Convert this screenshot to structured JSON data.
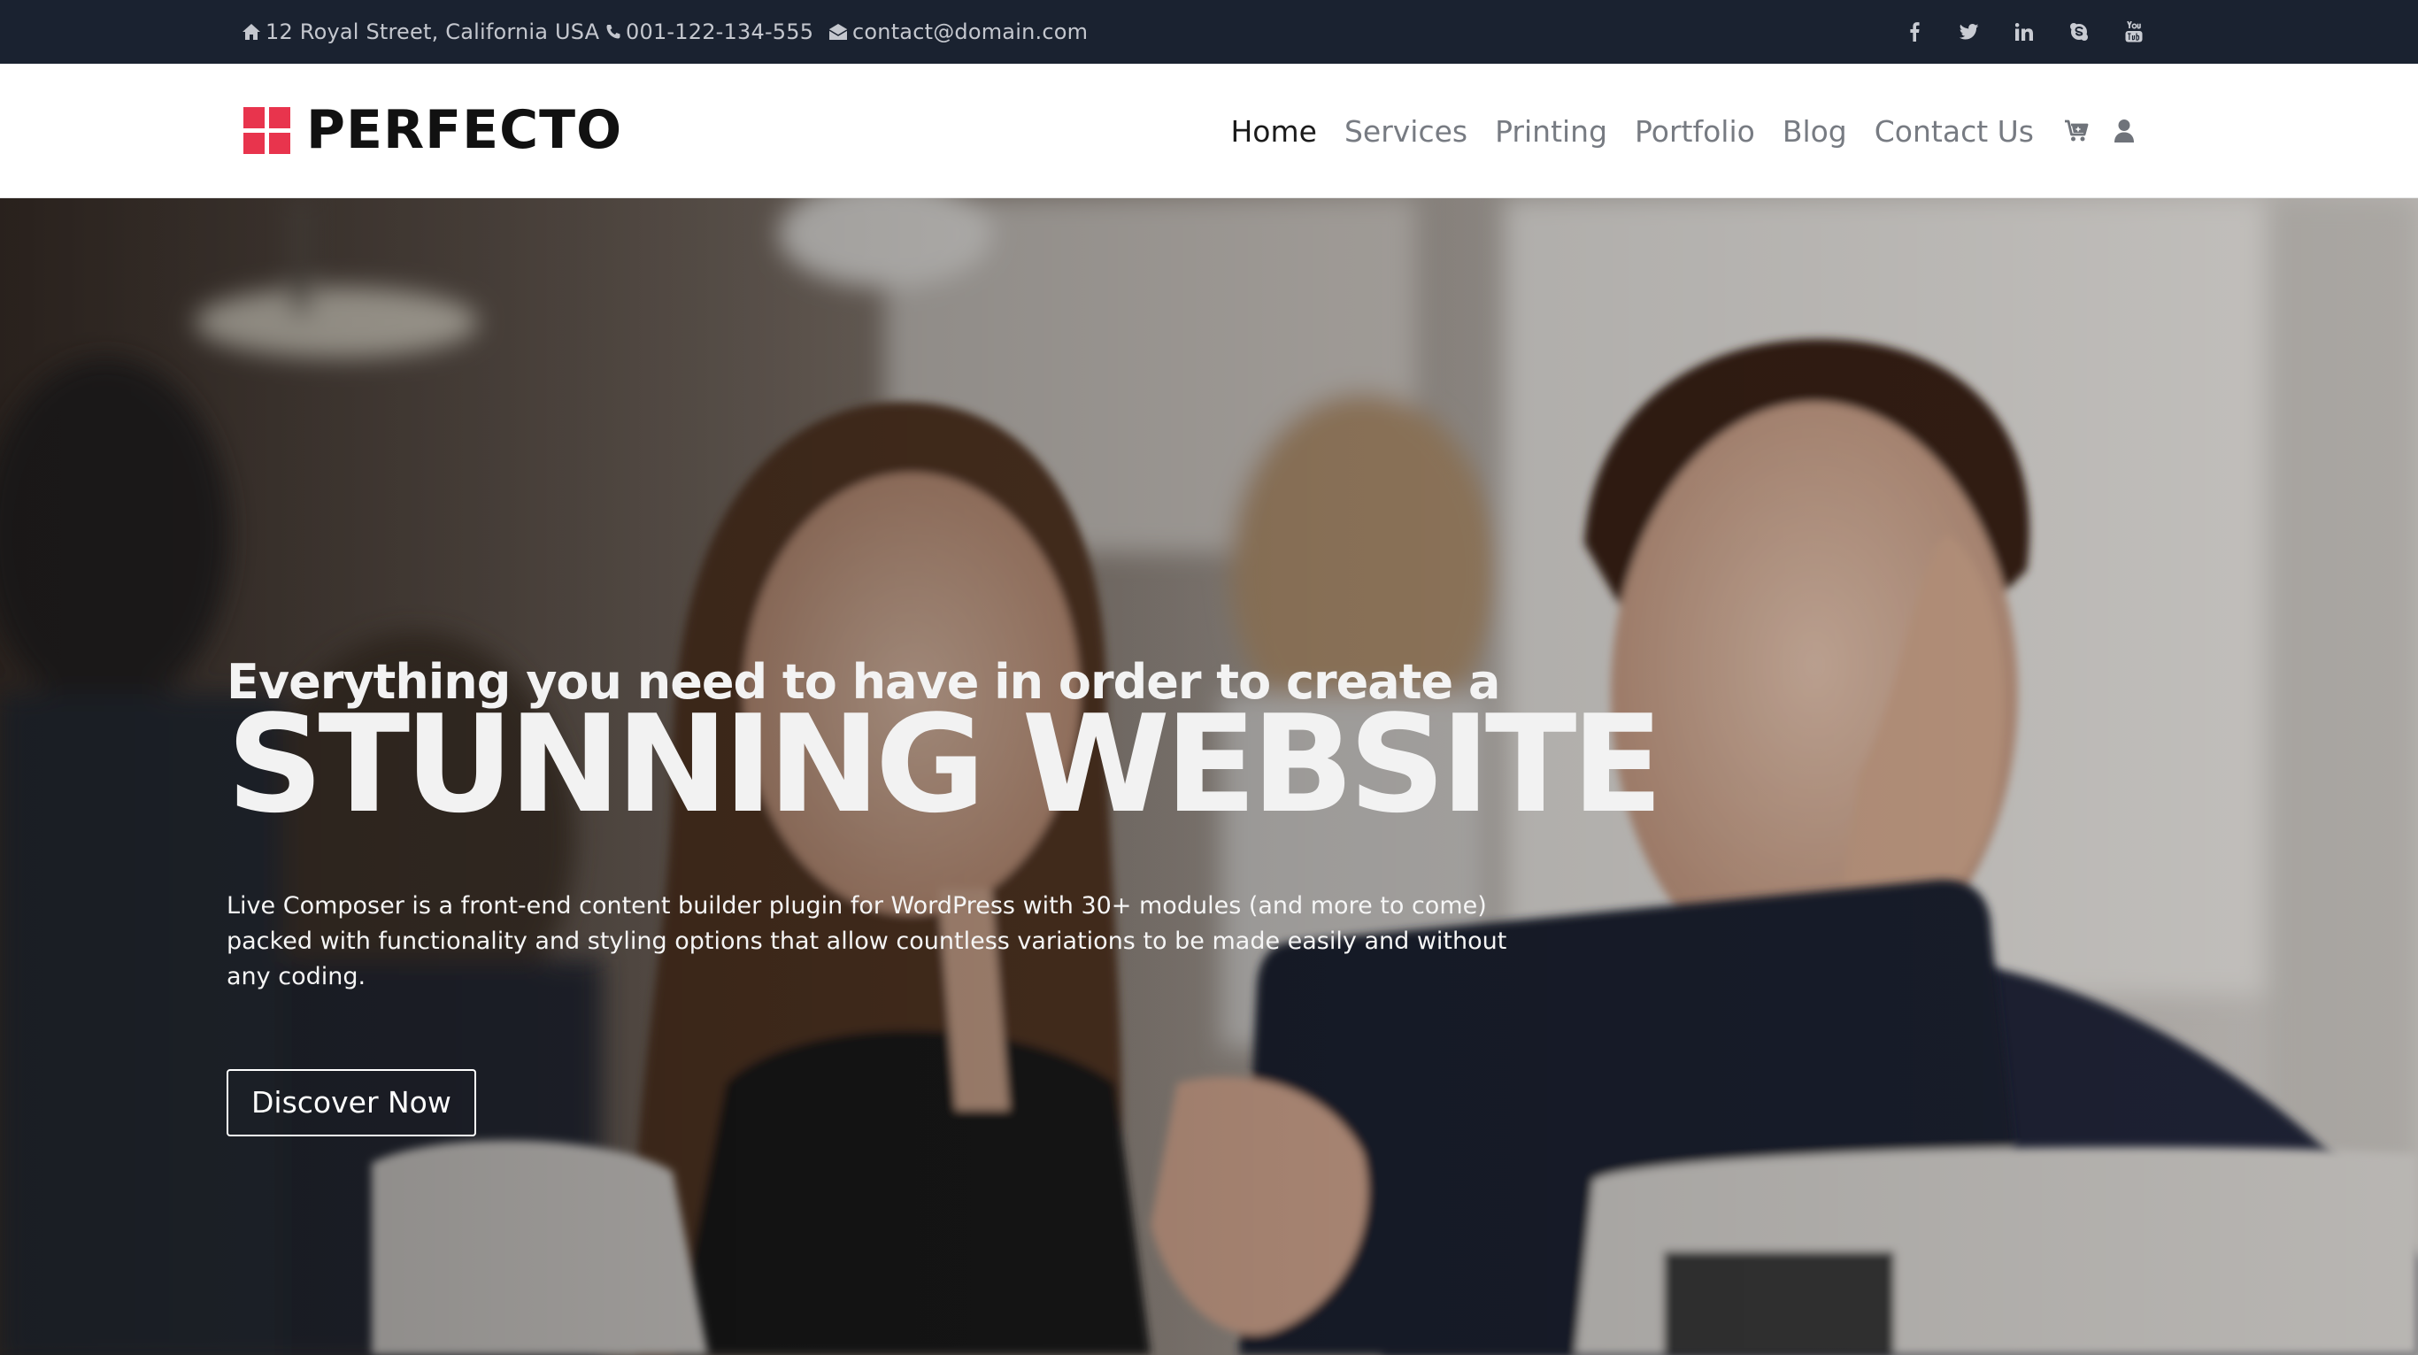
{
  "topbar": {
    "address": "12 Royal Street, California USA",
    "phone": "001-122-134-555",
    "email": "contact@domain.com",
    "socials": [
      "facebook-icon",
      "twitter-icon",
      "linkedin-icon",
      "skype-icon",
      "youtube-icon"
    ]
  },
  "header": {
    "logo_text": "PERFECTO",
    "nav": {
      "home": "Home",
      "services": "Services",
      "printing": "Printing",
      "portfolio": "Portfolio",
      "blog": "Blog",
      "contact": "Contact Us"
    },
    "icons": [
      "cart-icon",
      "user-icon"
    ]
  },
  "hero": {
    "kicker": "Everything you need to have in order to create a",
    "title": "STUNNING WEBSITE",
    "description": "Live Composer is a front-end content builder plugin for WordPress with 30+ modules (and more to come) packed with functionality and styling options that allow countless variations to be made easily and without any coding.",
    "cta_label": "Discover Now"
  },
  "colors": {
    "topbar_bg": "#1a2230",
    "brand_red": "#e8344d",
    "nav_active": "#1b1b1b",
    "nav_text": "#777b82"
  }
}
